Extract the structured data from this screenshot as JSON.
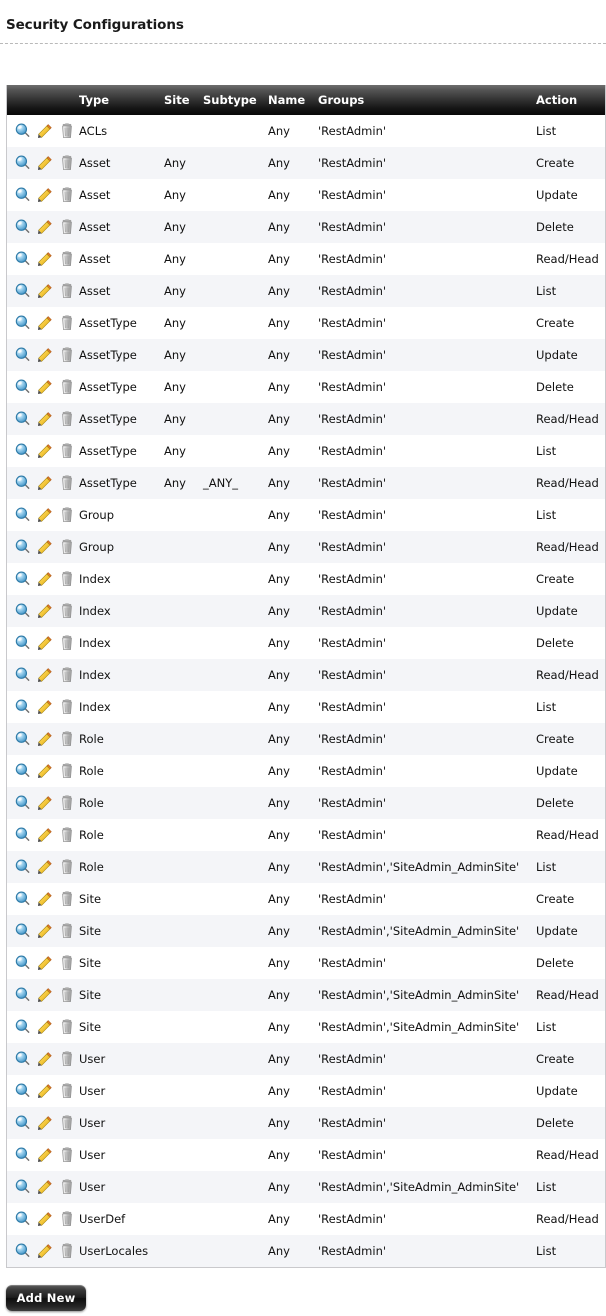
{
  "page": {
    "title": "Security Configurations"
  },
  "table": {
    "columns": [
      {
        "key": "actions",
        "label": ""
      },
      {
        "key": "type",
        "label": "Type"
      },
      {
        "key": "site",
        "label": "Site"
      },
      {
        "key": "subtype",
        "label": "Subtype"
      },
      {
        "key": "name",
        "label": "Name"
      },
      {
        "key": "groups",
        "label": "Groups"
      },
      {
        "key": "action",
        "label": "Action"
      }
    ],
    "row_icons": [
      {
        "name": "view-icon",
        "label": "View"
      },
      {
        "name": "edit-icon",
        "label": "Edit"
      },
      {
        "name": "delete-icon",
        "label": "Delete"
      }
    ],
    "rows": [
      {
        "type": "ACLs",
        "site": "",
        "subtype": "",
        "name": "Any",
        "groups": "'RestAdmin'",
        "action": "List"
      },
      {
        "type": "Asset",
        "site": "Any",
        "subtype": "",
        "name": "Any",
        "groups": "'RestAdmin'",
        "action": "Create"
      },
      {
        "type": "Asset",
        "site": "Any",
        "subtype": "",
        "name": "Any",
        "groups": "'RestAdmin'",
        "action": "Update"
      },
      {
        "type": "Asset",
        "site": "Any",
        "subtype": "",
        "name": "Any",
        "groups": "'RestAdmin'",
        "action": "Delete"
      },
      {
        "type": "Asset",
        "site": "Any",
        "subtype": "",
        "name": "Any",
        "groups": "'RestAdmin'",
        "action": "Read/Head"
      },
      {
        "type": "Asset",
        "site": "Any",
        "subtype": "",
        "name": "Any",
        "groups": "'RestAdmin'",
        "action": "List"
      },
      {
        "type": "AssetType",
        "site": "Any",
        "subtype": "",
        "name": "Any",
        "groups": "'RestAdmin'",
        "action": "Create"
      },
      {
        "type": "AssetType",
        "site": "Any",
        "subtype": "",
        "name": "Any",
        "groups": "'RestAdmin'",
        "action": "Update"
      },
      {
        "type": "AssetType",
        "site": "Any",
        "subtype": "",
        "name": "Any",
        "groups": "'RestAdmin'",
        "action": "Delete"
      },
      {
        "type": "AssetType",
        "site": "Any",
        "subtype": "",
        "name": "Any",
        "groups": "'RestAdmin'",
        "action": "Read/Head"
      },
      {
        "type": "AssetType",
        "site": "Any",
        "subtype": "",
        "name": "Any",
        "groups": "'RestAdmin'",
        "action": "List"
      },
      {
        "type": "AssetType",
        "site": "Any",
        "subtype": "_ANY_",
        "name": "Any",
        "groups": "'RestAdmin'",
        "action": "Read/Head"
      },
      {
        "type": "Group",
        "site": "",
        "subtype": "",
        "name": "Any",
        "groups": "'RestAdmin'",
        "action": "List"
      },
      {
        "type": "Group",
        "site": "",
        "subtype": "",
        "name": "Any",
        "groups": "'RestAdmin'",
        "action": "Read/Head"
      },
      {
        "type": "Index",
        "site": "",
        "subtype": "",
        "name": "Any",
        "groups": "'RestAdmin'",
        "action": "Create"
      },
      {
        "type": "Index",
        "site": "",
        "subtype": "",
        "name": "Any",
        "groups": "'RestAdmin'",
        "action": "Update"
      },
      {
        "type": "Index",
        "site": "",
        "subtype": "",
        "name": "Any",
        "groups": "'RestAdmin'",
        "action": "Delete"
      },
      {
        "type": "Index",
        "site": "",
        "subtype": "",
        "name": "Any",
        "groups": "'RestAdmin'",
        "action": "Read/Head"
      },
      {
        "type": "Index",
        "site": "",
        "subtype": "",
        "name": "Any",
        "groups": "'RestAdmin'",
        "action": "List"
      },
      {
        "type": "Role",
        "site": "",
        "subtype": "",
        "name": "Any",
        "groups": "'RestAdmin'",
        "action": "Create"
      },
      {
        "type": "Role",
        "site": "",
        "subtype": "",
        "name": "Any",
        "groups": "'RestAdmin'",
        "action": "Update"
      },
      {
        "type": "Role",
        "site": "",
        "subtype": "",
        "name": "Any",
        "groups": "'RestAdmin'",
        "action": "Delete"
      },
      {
        "type": "Role",
        "site": "",
        "subtype": "",
        "name": "Any",
        "groups": "'RestAdmin'",
        "action": "Read/Head"
      },
      {
        "type": "Role",
        "site": "",
        "subtype": "",
        "name": "Any",
        "groups": "'RestAdmin','SiteAdmin_AdminSite'",
        "action": "List"
      },
      {
        "type": "Site",
        "site": "",
        "subtype": "",
        "name": "Any",
        "groups": "'RestAdmin'",
        "action": "Create"
      },
      {
        "type": "Site",
        "site": "",
        "subtype": "",
        "name": "Any",
        "groups": "'RestAdmin','SiteAdmin_AdminSite'",
        "action": "Update"
      },
      {
        "type": "Site",
        "site": "",
        "subtype": "",
        "name": "Any",
        "groups": "'RestAdmin'",
        "action": "Delete"
      },
      {
        "type": "Site",
        "site": "",
        "subtype": "",
        "name": "Any",
        "groups": "'RestAdmin','SiteAdmin_AdminSite'",
        "action": "Read/Head"
      },
      {
        "type": "Site",
        "site": "",
        "subtype": "",
        "name": "Any",
        "groups": "'RestAdmin','SiteAdmin_AdminSite'",
        "action": "List"
      },
      {
        "type": "User",
        "site": "",
        "subtype": "",
        "name": "Any",
        "groups": "'RestAdmin'",
        "action": "Create"
      },
      {
        "type": "User",
        "site": "",
        "subtype": "",
        "name": "Any",
        "groups": "'RestAdmin'",
        "action": "Update"
      },
      {
        "type": "User",
        "site": "",
        "subtype": "",
        "name": "Any",
        "groups": "'RestAdmin'",
        "action": "Delete"
      },
      {
        "type": "User",
        "site": "",
        "subtype": "",
        "name": "Any",
        "groups": "'RestAdmin'",
        "action": "Read/Head"
      },
      {
        "type": "User",
        "site": "",
        "subtype": "",
        "name": "Any",
        "groups": "'RestAdmin','SiteAdmin_AdminSite'",
        "action": "List"
      },
      {
        "type": "UserDef",
        "site": "",
        "subtype": "",
        "name": "Any",
        "groups": "'RestAdmin'",
        "action": "Read/Head"
      },
      {
        "type": "UserLocales",
        "site": "",
        "subtype": "",
        "name": "Any",
        "groups": "'RestAdmin'",
        "action": "List"
      }
    ]
  },
  "footer": {
    "add_new_label": "Add New"
  },
  "colors": {
    "header_bg_dark": "#080808",
    "header_text": "#ffffff",
    "row_alt_bg": "#f4f5f8",
    "row_bg": "#ffffff",
    "grid_border": "#c9c9cc",
    "search_icon": "#5aa9d6",
    "edit_icon": "#f2c231",
    "delete_icon": "#9a9a9a"
  }
}
